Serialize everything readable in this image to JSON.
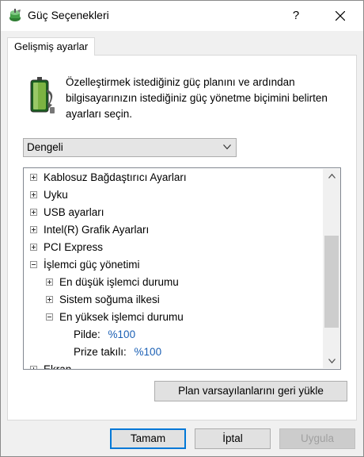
{
  "window": {
    "title": "Güç Seçenekleri",
    "help_label": "?",
    "close_icon": "close-icon"
  },
  "tab": {
    "label": "Gelişmiş ayarlar"
  },
  "description": "Özelleştirmek istediğiniz güç planını ve ardından bilgisayarınızın istediğiniz güç yönetme biçimini belirten ayarları seçin.",
  "plan_select": {
    "value": "Dengeli"
  },
  "tree": {
    "items": [
      {
        "label": "Kablosuz Bağdaştırıcı Ayarları",
        "expander": "+"
      },
      {
        "label": "Uyku",
        "expander": "+"
      },
      {
        "label": "USB ayarları",
        "expander": "+"
      },
      {
        "label": "Intel(R) Grafik Ayarları",
        "expander": "+"
      },
      {
        "label": "PCI Express",
        "expander": "+"
      },
      {
        "label": "İşlemci güç yönetimi",
        "expander": "-"
      },
      {
        "label": "En düşük işlemci durumu",
        "expander": "+"
      },
      {
        "label": "Sistem soğuma ilkesi",
        "expander": "+"
      },
      {
        "label": "En yüksek işlemci durumu",
        "expander": "-"
      },
      {
        "label": "Pilde:",
        "value": "%100"
      },
      {
        "label": "Prize takılı:",
        "value": "%100"
      },
      {
        "label": "Ekran",
        "expander": "+"
      }
    ]
  },
  "restore_button": "Plan varsayılanlarını geri yükle",
  "buttons": {
    "ok": "Tamam",
    "cancel": "İptal",
    "apply": "Uygula"
  },
  "colors": {
    "accent": "#0078d7",
    "setting_value": "#1a5fb4"
  }
}
